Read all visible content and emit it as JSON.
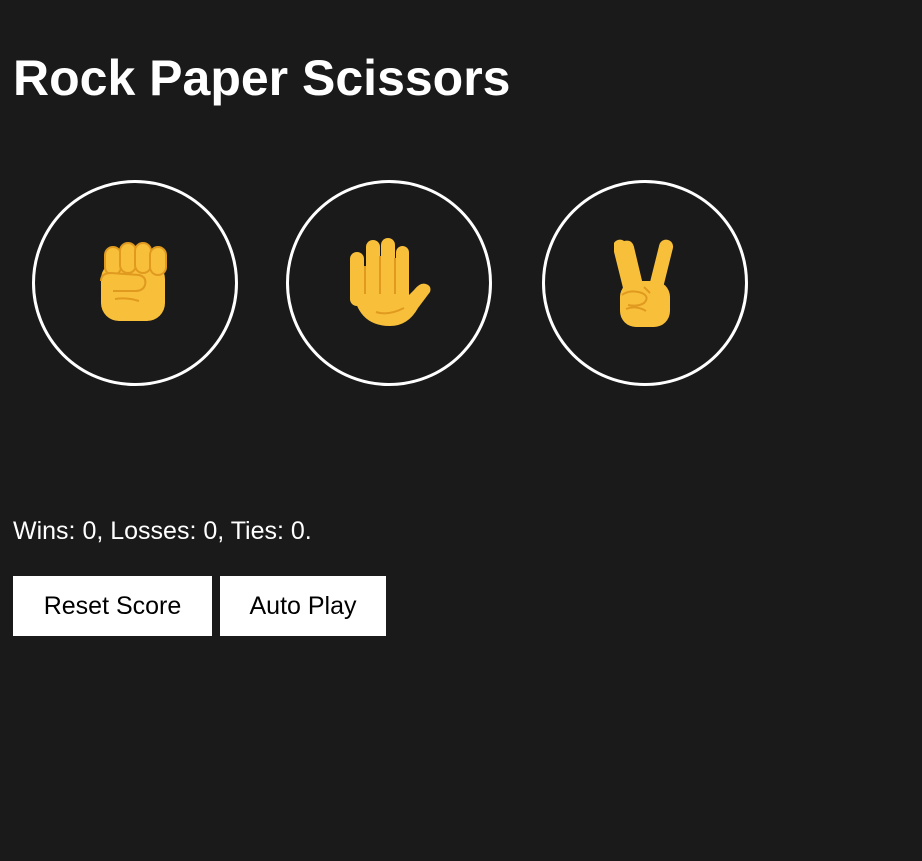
{
  "game": {
    "title": "Rock Paper Scissors"
  },
  "moves": [
    {
      "name": "rock",
      "icon": "raised-fist-icon"
    },
    {
      "name": "paper",
      "icon": "raised-hand-icon"
    },
    {
      "name": "scissors",
      "icon": "victory-hand-icon"
    }
  ],
  "score": {
    "text": "Wins: 0, Losses: 0, Ties: 0."
  },
  "buttons": {
    "reset_label": "Reset Score",
    "auto_play_label": "Auto Play"
  },
  "colors": {
    "background": "#1a1a1a",
    "text": "#ffffff",
    "button_background": "#ffffff",
    "emoji_yellow": "#f8bf3a"
  }
}
